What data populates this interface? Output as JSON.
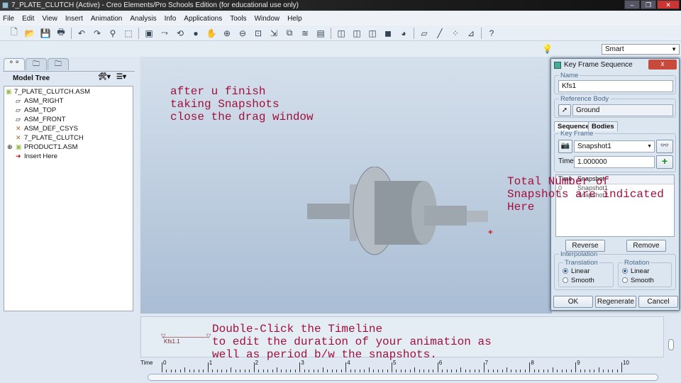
{
  "window": {
    "title": "7_PLATE_CLUTCH (Active) - Creo Elements/Pro Schools Edition (for educational use only)"
  },
  "menu": [
    "File",
    "Edit",
    "View",
    "Insert",
    "Animation",
    "Analysis",
    "Info",
    "Applications",
    "Tools",
    "Window",
    "Help"
  ],
  "filter": {
    "value": "Smart"
  },
  "model_tree": {
    "title": "Model Tree",
    "items": [
      {
        "label": "7_PLATE_CLUTCH.ASM",
        "icon": "assembly-icon"
      },
      {
        "label": "ASM_RIGHT",
        "icon": "datum-plane-icon"
      },
      {
        "label": "ASM_TOP",
        "icon": "datum-plane-icon"
      },
      {
        "label": "ASM_FRONT",
        "icon": "datum-plane-icon"
      },
      {
        "label": "ASM_DEF_CSYS",
        "icon": "csys-icon"
      },
      {
        "label": "7_PLATE_CLUTCH",
        "icon": "csys-icon"
      },
      {
        "label": "PRODUCT1.ASM",
        "icon": "assembly-icon"
      },
      {
        "label": "Insert Here",
        "icon": "insert-arrow-icon"
      }
    ]
  },
  "annotations": {
    "top": "after u finish\ntaking Snapshots\nclose the drag window",
    "right": "Total Number of\nSnapshots are indicated\nHere",
    "bottom": "Double-Click the Timeline\nto edit the duration of your animation as\nwell as period b/w the snapshots."
  },
  "dialog": {
    "title": "Key Frame Sequence",
    "close": "x",
    "name_label": "Name",
    "name_value": "Kfs1",
    "ref_label": "Reference Body",
    "ref_value": "Ground",
    "tabs": [
      "Sequence",
      "Bodies"
    ],
    "keyframe_label": "Key Frame",
    "snapshot_value": "Snapshot1",
    "time_label": "Time",
    "time_value": "1.000000",
    "table": {
      "headers": [
        "Time",
        "Snapshot"
      ],
      "rows": [
        [
          "0",
          "Snapshot1"
        ],
        [
          "1",
          "Snapshot2"
        ]
      ]
    },
    "reverse": "Reverse",
    "remove": "Remove",
    "interp_label": "Interpolation",
    "translation_label": "Translation",
    "rotation_label": "Rotation",
    "linear": "Linear",
    "smooth": "Smooth",
    "ok": "OK",
    "regenerate": "Regenerate",
    "cancel": "Cancel"
  },
  "timeline": {
    "label": "Time",
    "kfs_label": "Kfs1.1",
    "ticks": [
      "0",
      "1",
      "2",
      "3",
      "4",
      "5",
      "6",
      "7",
      "8",
      "9",
      "10"
    ]
  }
}
